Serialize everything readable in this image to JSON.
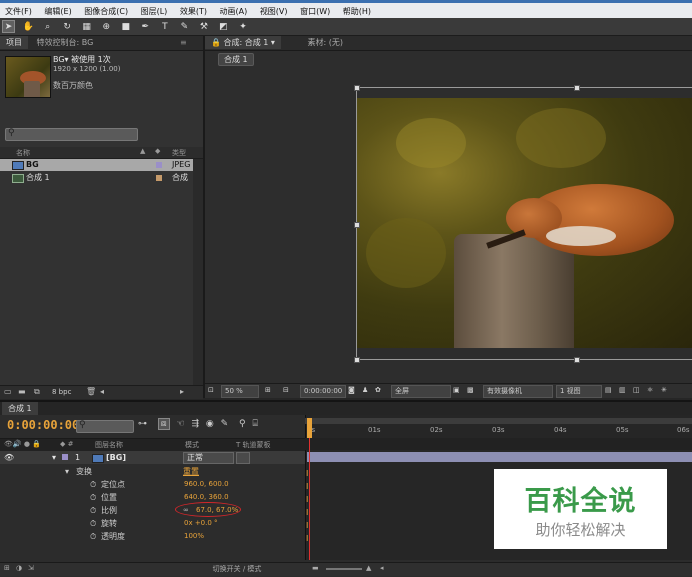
{
  "menubar": {
    "items": [
      "文件(F)",
      "编辑(E)",
      "图像合成(C)",
      "图层(L)",
      "效果(T)",
      "动画(A)",
      "视图(V)",
      "窗口(W)",
      "帮助(H)"
    ]
  },
  "project_panel": {
    "tab_project": "项目",
    "tab_effects": "特效控制台: BG",
    "asset_name": "BG▾ 被使用 1次",
    "asset_dims": "1920 x 1200 (1.00)",
    "asset_color": "数百万颜色",
    "col_name": "名称",
    "col_type": "类型",
    "items": [
      {
        "name": "BG",
        "type": "JPEG"
      },
      {
        "name": "合成 1",
        "type": "合成"
      }
    ],
    "bpc": "8 bpc"
  },
  "comp_panel": {
    "tab_comp": "合成: 合成 1",
    "tab_footage": "素材: (无)",
    "subtab": "合成 1",
    "zoom": "50 %",
    "timecode": "0:00:00:00",
    "resolution": "全屏",
    "camera": "有效摄像机",
    "views": "1 视图"
  },
  "timeline": {
    "tab": "合成 1",
    "timecode": "0:00:00:00",
    "col_layer_name": "图层名称",
    "col_mode": "模式",
    "col_trkmat": "T  轨道蒙板",
    "layer_num": "1",
    "layer_name": "[BG]",
    "layer_mode": "正常",
    "transform_label": "变换",
    "transform_reset": "重置",
    "properties": [
      {
        "name": "定位点",
        "value": "960.0, 600.0"
      },
      {
        "name": "位置",
        "value": "640.0, 360.0"
      },
      {
        "name": "比例",
        "value": "67.0, 67.0%"
      },
      {
        "name": "旋转",
        "value": "0x +0.0 °"
      },
      {
        "name": "透明度",
        "value": "100%"
      }
    ],
    "ruler": [
      "0s",
      "01s",
      "02s",
      "03s",
      "04s",
      "05s",
      "06s"
    ],
    "bottom_toggle": "切换开关 / 模式"
  },
  "watermark": {
    "title": "百科全说",
    "subtitle": "助你轻松解决"
  },
  "colors": {
    "accent_orange": "#e8a33a",
    "highlight_red": "#d0262a",
    "timeline_bar": "#8d8fb3"
  }
}
